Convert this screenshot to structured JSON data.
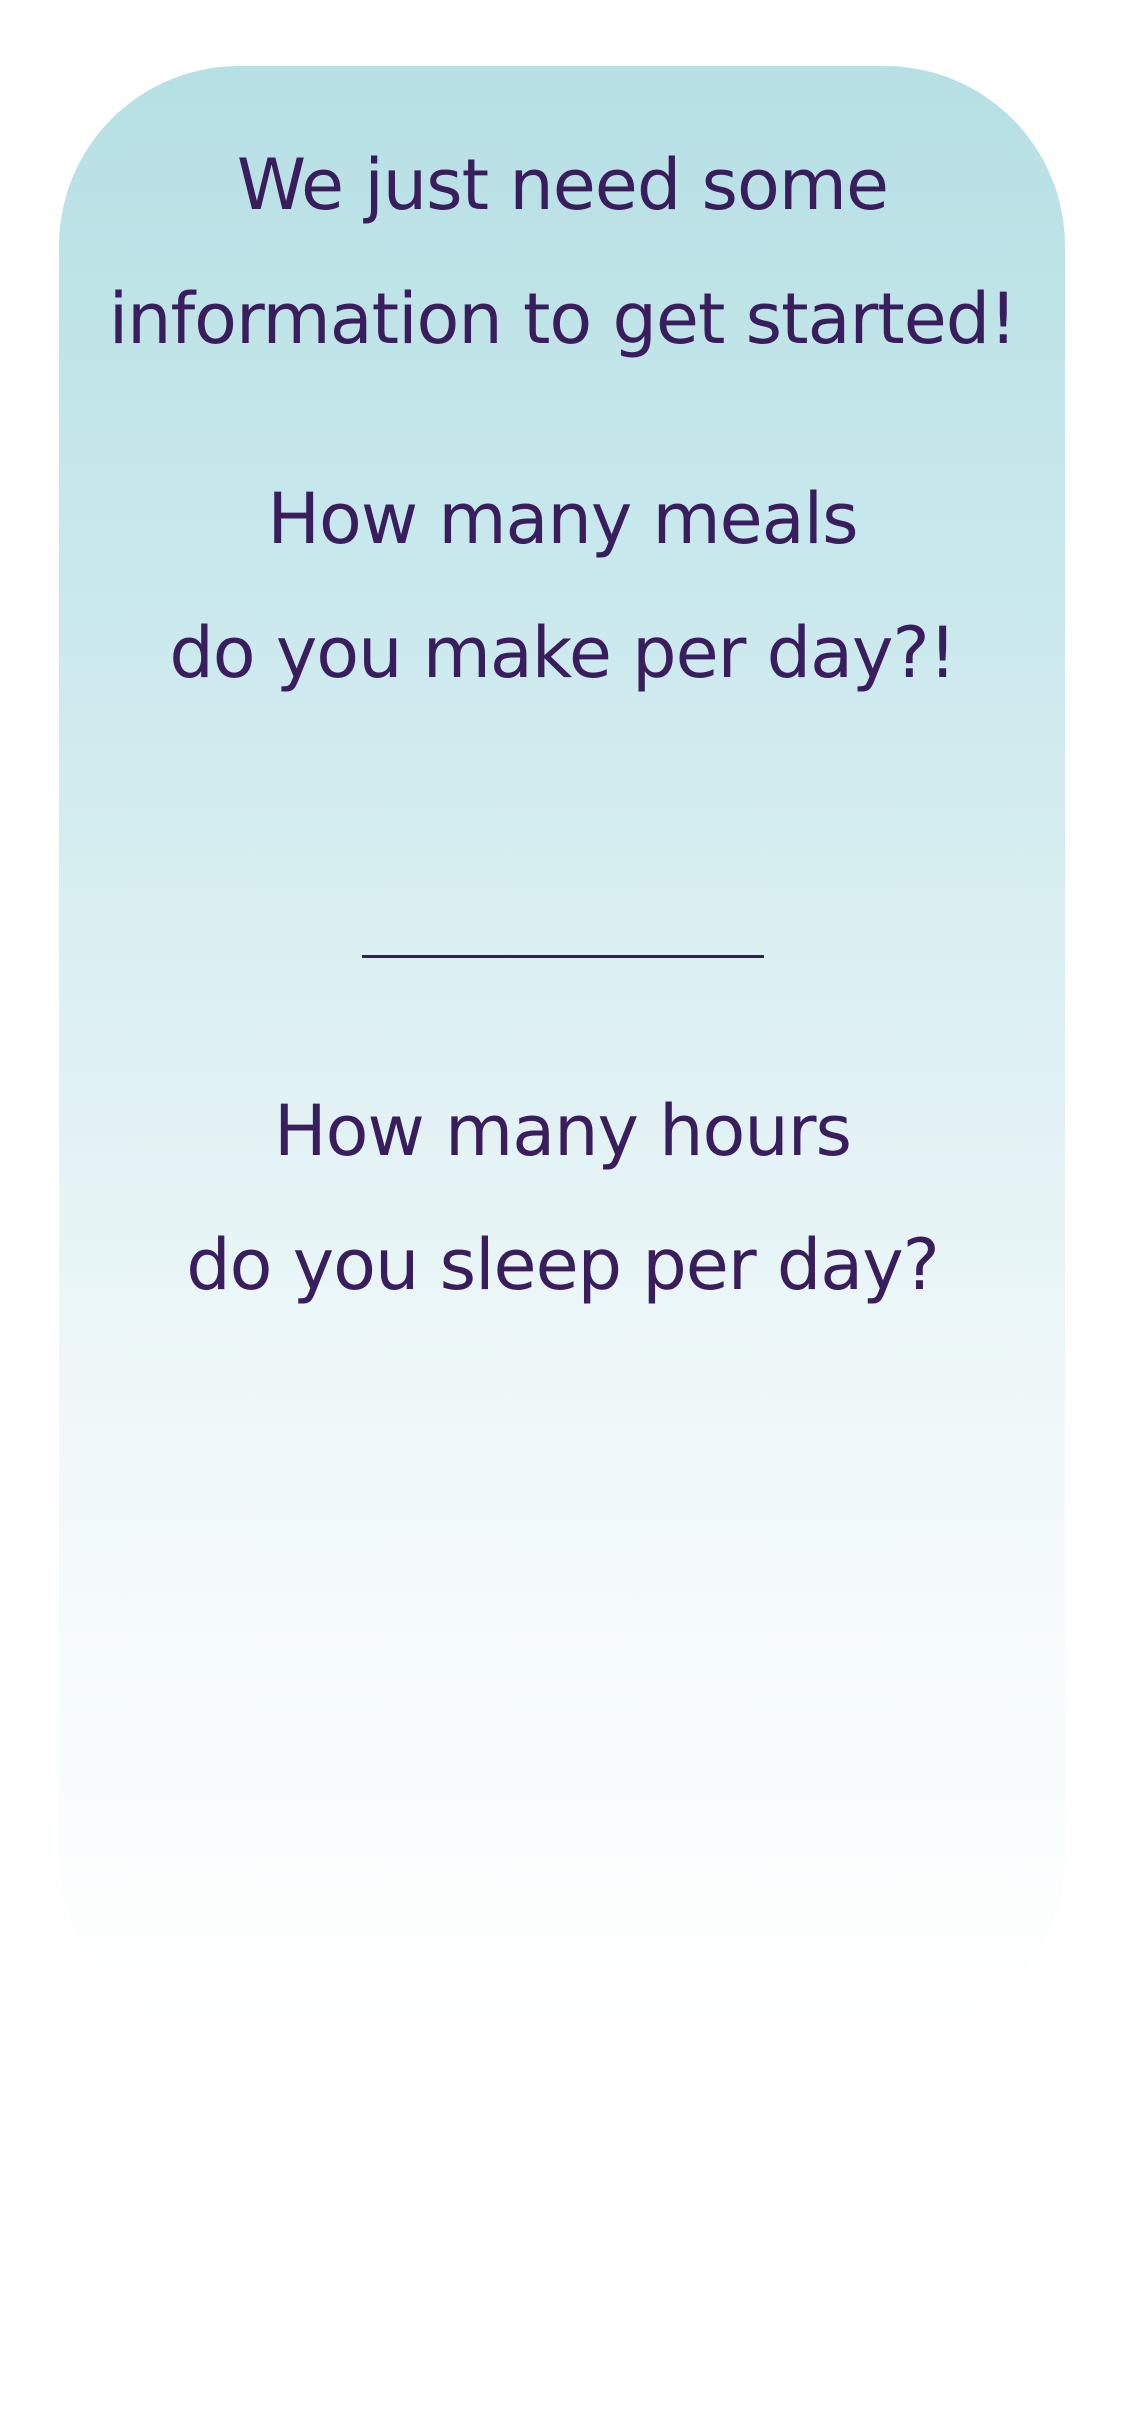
{
  "intro": {
    "line1": "We just need some",
    "line2": "information to get started!"
  },
  "questions": [
    {
      "line1": "How many meals",
      "line2": "do you make per day?!",
      "answer_value": ""
    },
    {
      "line1": "How many hours",
      "line2": "do you sleep per day?",
      "answer_value": ""
    }
  ],
  "colors": {
    "text": "#3a1d5c",
    "card_top": "#b6e0e4",
    "card_bottom": "#ffffff"
  }
}
